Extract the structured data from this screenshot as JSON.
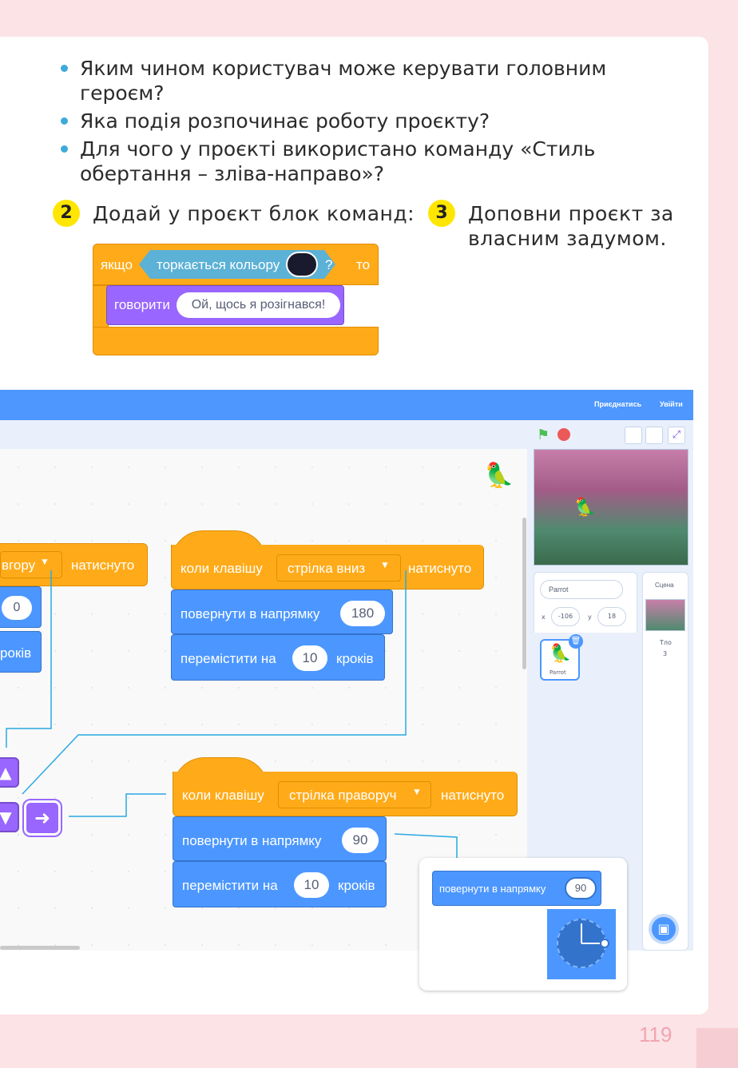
{
  "questions": [
    "Яким чином користувач може керувати головним героєм?",
    "Яка подія розпочинає роботу проєкту?",
    "Для чого у проєкті використано команду «Стиль обертання – зліва-направо»?"
  ],
  "task2": {
    "number": "2",
    "text": "Додай у проєкт блок команд:"
  },
  "task3": {
    "number": "3",
    "text": "Доповни проєкт за власним задумом."
  },
  "example_block": {
    "if_label": "якщо",
    "sensing_label": "торкається кольору",
    "question_mark": "?",
    "then_label": "то",
    "say_label": "говорити",
    "say_text": "Ой, щось я розігнався!",
    "color_swatch": "#1a1a2e"
  },
  "editor": {
    "menu_join": "Приєднатись",
    "menu_login": "Увійти",
    "script_up": {
      "key_tail": "вгору",
      "pressed": "натиснуто",
      "value": "0",
      "steps_tail": "років"
    },
    "script_down": {
      "when_key": "коли клавішу",
      "key": "стрілка вниз",
      "pressed": "натиснуто",
      "turn": "повернути в напрямку",
      "turn_value": "180",
      "move": "перемістити на",
      "move_value": "10",
      "steps": "кроків"
    },
    "script_right": {
      "when_key": "коли клавішу",
      "key": "стрілка праворуч",
      "pressed": "натиснуто",
      "turn": "повернути в напрямку",
      "turn_value": "90",
      "move": "перемістити на",
      "move_value": "10",
      "steps": "кроків"
    },
    "popup": {
      "turn": "повернути в напрямку",
      "value": "90"
    },
    "sprite_panel": {
      "name": "Parrot",
      "x_label": "x",
      "x_value": "-106",
      "y_label": "y",
      "y_value": "18",
      "thumb_label": "Parrot"
    },
    "stage_panel": {
      "title": "Сцена",
      "backdrops_label": "Тло",
      "backdrops_count": "3"
    },
    "colors": {
      "motion": "#4c97ff",
      "events": "#ffab19",
      "looks": "#9966ff",
      "topbar": "#4d97ff"
    }
  },
  "page_number": "119"
}
